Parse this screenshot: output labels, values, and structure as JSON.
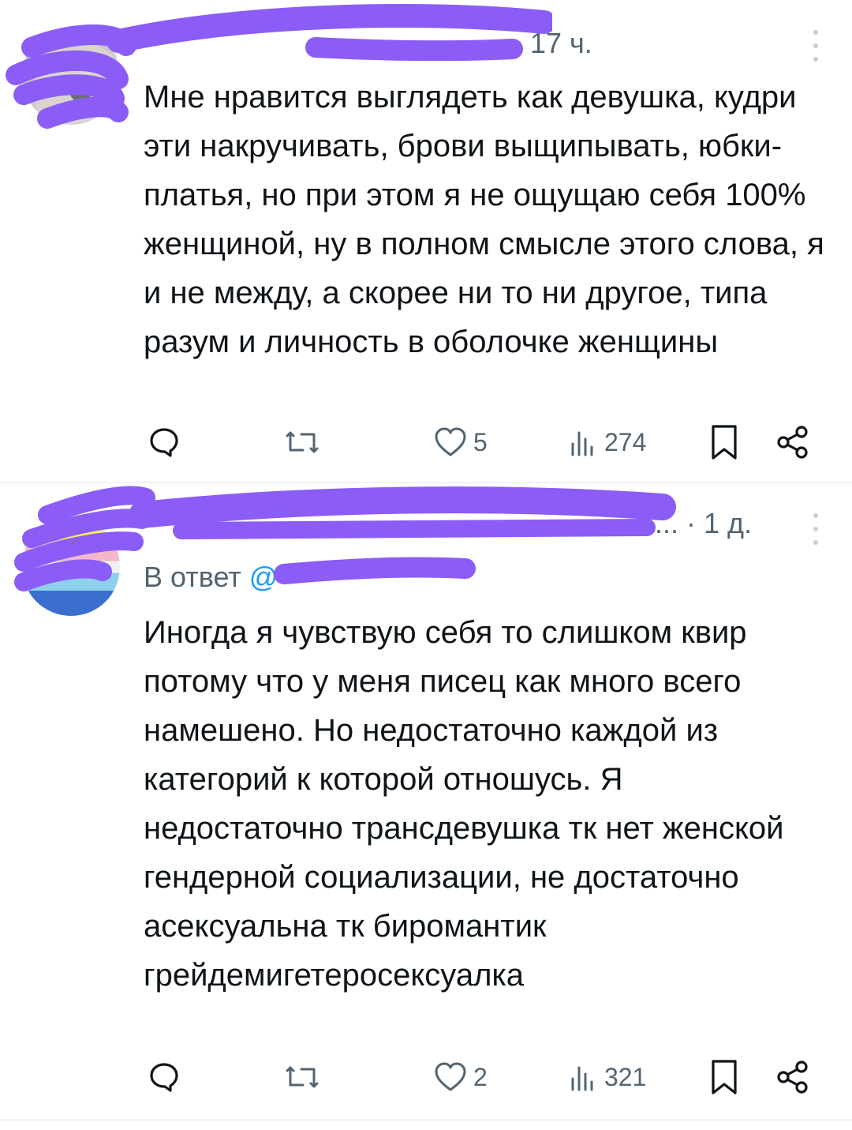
{
  "tweets": [
    {
      "name": "",
      "time": "· 17 ч.",
      "reply_label": "",
      "reply_handle": "",
      "text": "Мне нравится выглядеть как девушка, кудри эти накручивать, брови выщипывать, юбки-платья, но при этом я не ощущаю себя 100% женщиной, ну в полном смысле этого слова, я и не между, а скорее ни то ни другое, типа разум и личность в оболочке женщины",
      "likes": "5",
      "views": "274"
    },
    {
      "name": "",
      "time": "... · 1 д.",
      "reply_label": "В ответ",
      "reply_handle": "@",
      "text": "Иногда я чувствую себя то слишком квир потому что у меня писец как много всего намешено. Но недостаточно каждой из категорий к которой отношусь. Я недостаточно трансдевушка тк нет женской гендерной социализации, не достаточно асексуальна тк  биромантик грейдемигетеросексуалка",
      "likes": "2",
      "views": "321"
    }
  ],
  "icons": {
    "reply": "comment-bubble-icon",
    "retweet": "retweet-icon",
    "like": "heart-icon",
    "views": "bar-chart-icon",
    "bookmark": "bookmark-icon",
    "share": "share-icon",
    "more": "vertical-dots-icon"
  },
  "colors": {
    "text": "#0f1419",
    "muted": "#536471",
    "link": "#1d9bf0",
    "redaction": "#8b5cf6",
    "divider": "#eff3f4"
  }
}
